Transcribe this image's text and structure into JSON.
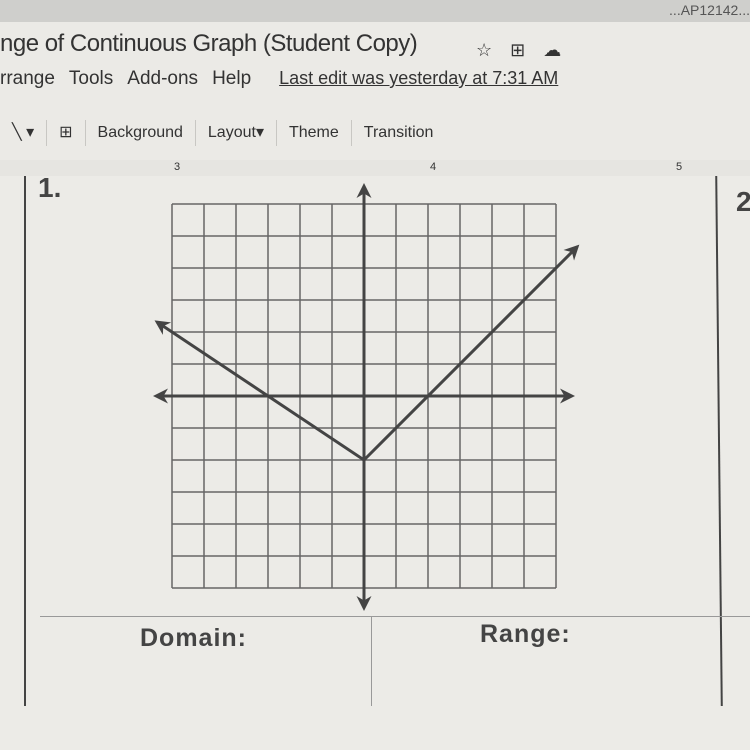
{
  "window": {
    "title": "nge of Continuous Graph (Student Copy)",
    "top_fragment": "...AP12142..."
  },
  "title_icons": [
    "star-icon",
    "move-to-folder-icon",
    "cloud-status-icon"
  ],
  "menu": {
    "items": [
      "rrange",
      "Tools",
      "Add-ons",
      "Help"
    ],
    "last_edit": "Last edit was yesterday at 7:31 AM"
  },
  "toolbar": {
    "background": "Background",
    "layout": "Layout",
    "theme": "Theme",
    "transition": "Transition"
  },
  "ruler": {
    "labels": [
      "3",
      "4",
      "5"
    ]
  },
  "slide": {
    "problem_1": "1.",
    "problem_2": "2",
    "domain_label": "Domain:",
    "range_label": "Range:"
  },
  "chart_data": {
    "type": "line",
    "xlim": [
      -6,
      6
    ],
    "ylim": [
      -6,
      6
    ],
    "grid": true,
    "series": [
      {
        "points": [
          [
            -6,
            2
          ],
          [
            0,
            -2
          ],
          [
            6,
            4
          ]
        ],
        "arrows": "both-ends"
      }
    ],
    "description_function": "piecewise linear V with vertex (0,-2)"
  }
}
